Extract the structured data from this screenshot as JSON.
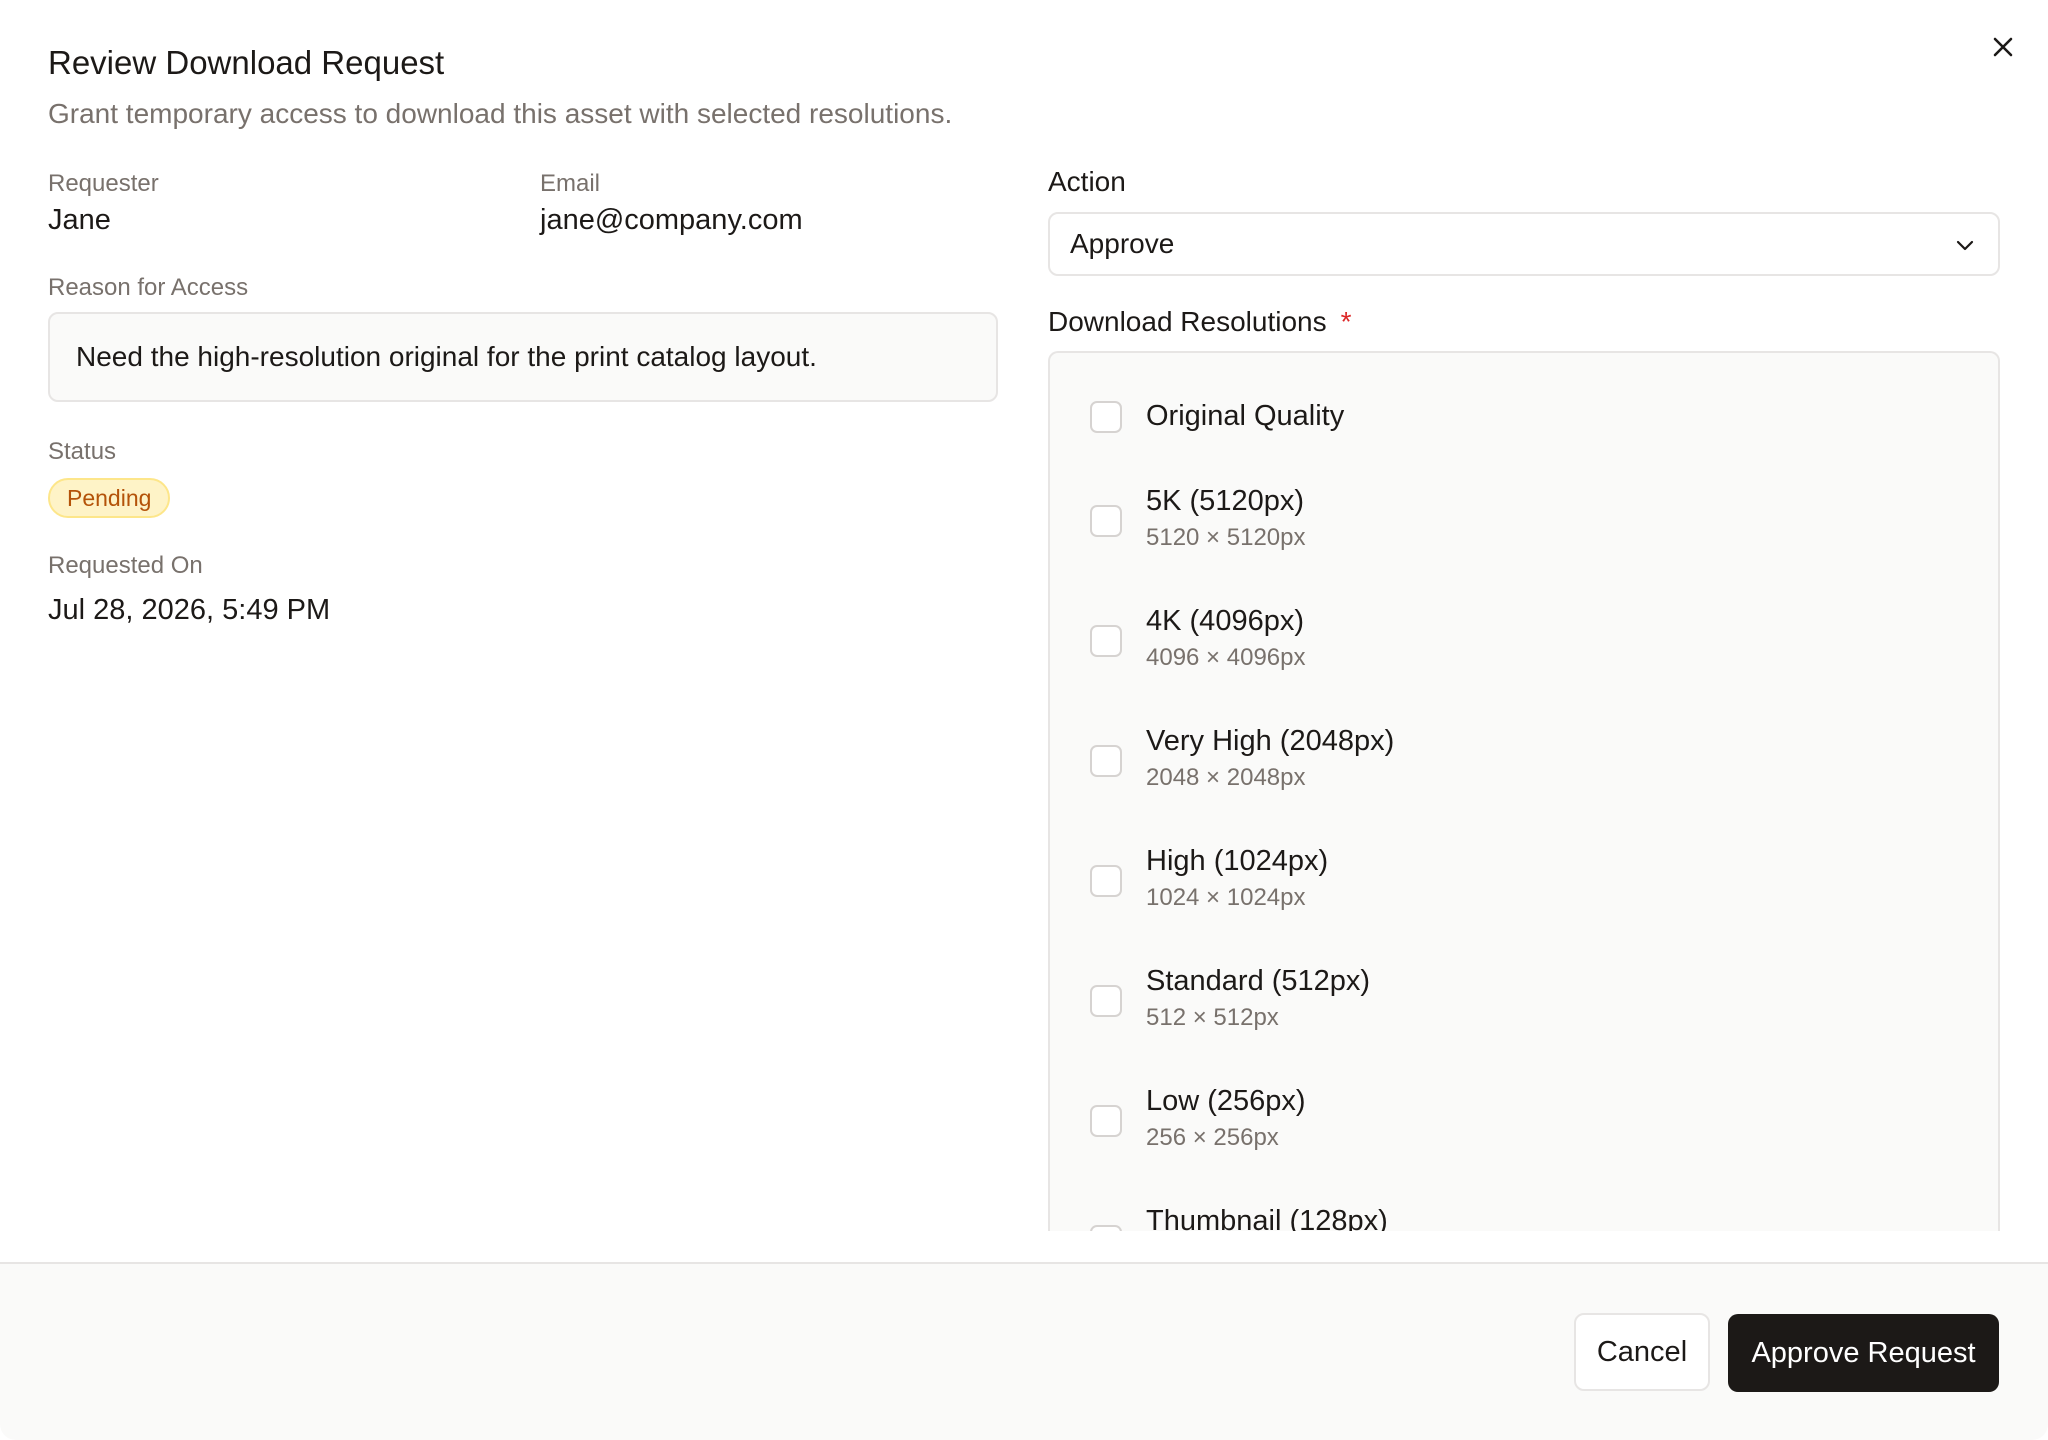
{
  "dialog": {
    "title": "Review Download Request",
    "subtitle": "Grant temporary access to download this asset with selected resolutions."
  },
  "details": {
    "requester_label": "Requester",
    "requester_value": "Jane",
    "email_label": "Email",
    "email_value": "jane@company.com",
    "reason_label": "Reason for Access",
    "reason_value": "Need the high-resolution original for the print catalog layout.",
    "status_label": "Status",
    "status_value": "Pending",
    "requested_on_label": "Requested On",
    "requested_on_value": "Jul 28, 2026, 5:49 PM"
  },
  "action": {
    "label": "Action",
    "selected": "Approve"
  },
  "resolutions": {
    "label": "Download Resolutions",
    "required_marker": "*",
    "items": [
      {
        "name": "Original Quality",
        "dims": "",
        "checked": false
      },
      {
        "name": "5K (5120px)",
        "dims": "5120 × 5120px",
        "checked": false
      },
      {
        "name": "4K (4096px)",
        "dims": "4096 × 4096px",
        "checked": false
      },
      {
        "name": "Very High (2048px)",
        "dims": "2048 × 2048px",
        "checked": false
      },
      {
        "name": "High (1024px)",
        "dims": "1024 × 1024px",
        "checked": false
      },
      {
        "name": "Standard (512px)",
        "dims": "512 × 512px",
        "checked": false
      },
      {
        "name": "Low (256px)",
        "dims": "256 × 256px",
        "checked": false
      },
      {
        "name": "Thumbnail (128px)",
        "dims": "",
        "checked": false
      }
    ]
  },
  "footer": {
    "cancel_label": "Cancel",
    "approve_label": "Approve Request"
  },
  "colors": {
    "primary_button": "#1c1917",
    "status_badge_bg": "#fef3c7",
    "status_badge_text": "#b45309",
    "required_marker": "#dc2626"
  },
  "icons": {
    "close": "close-icon",
    "select_chevron": "chevron-down-icon"
  }
}
